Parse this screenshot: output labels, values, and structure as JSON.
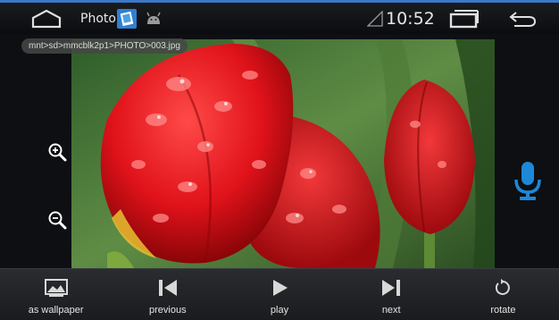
{
  "statusbar": {
    "app_title": "Photo",
    "time": "10:52"
  },
  "viewer": {
    "path": "mnt>sd>mmcblk2p1>PHOTO>003.jpg"
  },
  "toolbar": {
    "items": [
      {
        "label": "as wallpaper",
        "icon": "wallpaper-icon"
      },
      {
        "label": "previous",
        "icon": "skip-previous-icon"
      },
      {
        "label": "play",
        "icon": "play-icon"
      },
      {
        "label": "next",
        "icon": "skip-next-icon"
      },
      {
        "label": "rotate",
        "icon": "rotate-icon"
      }
    ]
  },
  "colors": {
    "accent": "#3a78c8",
    "mic": "#1e88d8"
  }
}
